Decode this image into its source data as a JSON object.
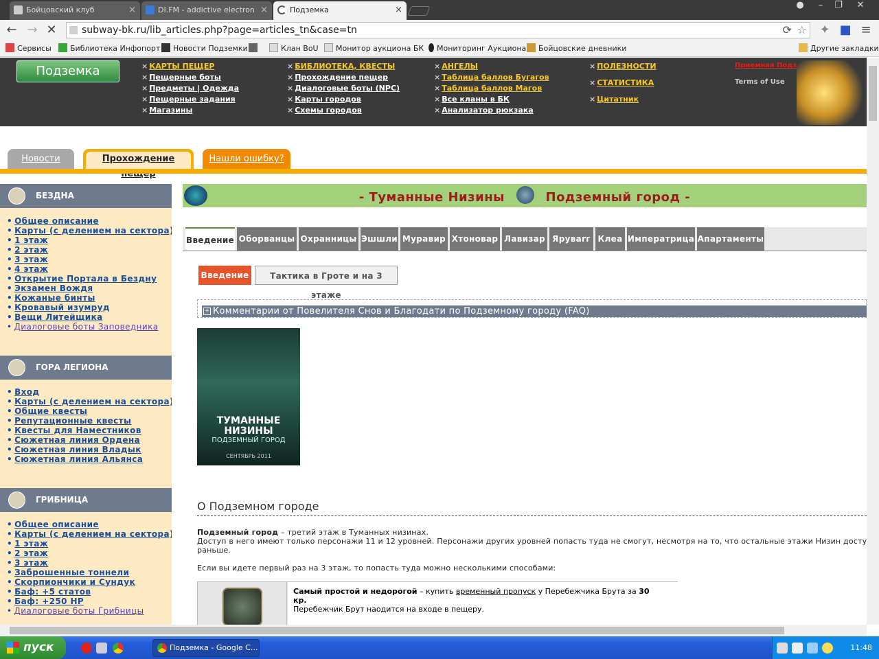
{
  "browser": {
    "tabs": [
      {
        "title": "Бойцовский клуб"
      },
      {
        "title": "DI.FM - addictive electron"
      },
      {
        "title": "Подземка"
      }
    ],
    "url": "subway-bk.ru/lib_articles.php?page=articles_tn&case=tn",
    "bookmarks": [
      "Сервисы",
      "Библиотека Инфопорт",
      "Новости Подземки",
      "Клан BoU",
      "Монитор аукциона БК",
      "Мониторинг Аукциона",
      "Бойцовские дневники",
      "Другие закладки"
    ]
  },
  "site": {
    "logo": "Подземка",
    "nav": {
      "col1": [
        "КАРТЫ ПЕЩЕР",
        "Пещерные боты",
        "Предметы",
        "Одежда",
        "Пещерные задания",
        "Магазины"
      ],
      "col2": [
        "БИБЛИОТЕКА, КВЕСТЫ",
        "Прохождение пещер",
        "Диалоговые боты (NPC)",
        "Карты городов",
        "Схемы городов"
      ],
      "col3": [
        "АНГЕЛЫ",
        "Таблица баллов Бугагов",
        "Таблица баллов Магов",
        "Все кланы в БК",
        "Анализатор рюкзака"
      ],
      "col4": [
        "ПОЛЕЗНОСТИ",
        "СТАТИСТИКА",
        "Цитатник"
      ],
      "reception": "Приемная Подземки",
      "terms": "Terms of Use",
      "separator": "|"
    },
    "tabs": [
      "Новости",
      "Прохождение пещер",
      "Нашли ошибку?"
    ]
  },
  "sidebar": {
    "sections": [
      {
        "title": "БЕЗДНА",
        "links": [
          "Общее описание",
          "Карты (с делением на сектора)",
          "1 этаж",
          "2 этаж",
          "3 этаж",
          "4 этаж",
          "Открытие Портала в Бездну",
          "Экзамен Вождя",
          "Кожаные бинты",
          "Кровавый изумруд",
          "Вещи Литейщика"
        ],
        "extra": "Диалоговые боты Заповедника"
      },
      {
        "title": "ГОРА ЛЕГИОНА",
        "links": [
          "Вход",
          "Карты (с делением на сектора)",
          "Общие квесты",
          "Репутационные квесты",
          "Квесты для Наместников",
          "Сюжетная линия Ордена",
          "Сюжетная линия Владык",
          "Сюжетная линия Альянса"
        ]
      },
      {
        "title": "ГРИБНИЦА",
        "links": [
          "Общее описание",
          "Карты (с делением на сектора)",
          "1 этаж",
          "2 этаж",
          "3 этаж",
          "Заброшенные тоннели",
          "Скорпиончики и Сундук",
          "Баф: +5 статов",
          "Баф: +250 HP"
        ],
        "extra": "Диалоговые боты Грибницы"
      }
    ]
  },
  "content": {
    "title_left": "- Туманные Низины",
    "title_right": "Подземный город -",
    "tabs": [
      "Введение",
      "Оборванцы",
      "Охранницы",
      "Эшшли",
      "Муравир",
      "Хтоновар",
      "Лавизар",
      "Яруваrг",
      "Клеа",
      "Императрица",
      "Апартаменты"
    ],
    "subtabs": [
      "Введение",
      "Тактика в Гроте и на 3 этаже"
    ],
    "comments_bar": "Комментарии от Повелителя Снов и Благодати по Подземному городу (FAQ)",
    "poster": {
      "title_line1": "ТУМАННЫЕ НИЗИНЫ",
      "title_line2": "ПОДЗЕМНЫЙ ГОРОД",
      "date": "СЕНТЯБРЬ 2011"
    },
    "heading": "О Подземном городе",
    "para1_bold": "Подземный город",
    "para1_rest": " – третий этаж в Туманных низинах.",
    "para2": "Доступ в него имеют только персонажи 11 и 12 уровней. Персонажи других уровней попасть туда не смогут, несмотря на то, что остальные этажи Низин доступны",
    "para2b": "раньше.",
    "para3": "Если вы идете первый раз на 3 этаж, то попасть туда можно несколькими способами:",
    "info": {
      "bold": "Самый простой и недорогой",
      "text1": " – купить ",
      "link": "временный пропуск",
      "text2": " у Перебежчика Брута за ",
      "price": "30",
      "unit": "кр.",
      "line2": "Перебежчик Брут наодится на входе в пещеру."
    }
  },
  "taskbar": {
    "start": "пуск",
    "window": "Подземка - Google C...",
    "clock": "11:48"
  },
  "colors": {
    "accent_orange": "#f5ad00",
    "title_red": "#9b1c1c",
    "nav_yellow": "#f7c82a",
    "sidebar_bg": "#fde9c2",
    "section_head": "#6e7b8f"
  }
}
